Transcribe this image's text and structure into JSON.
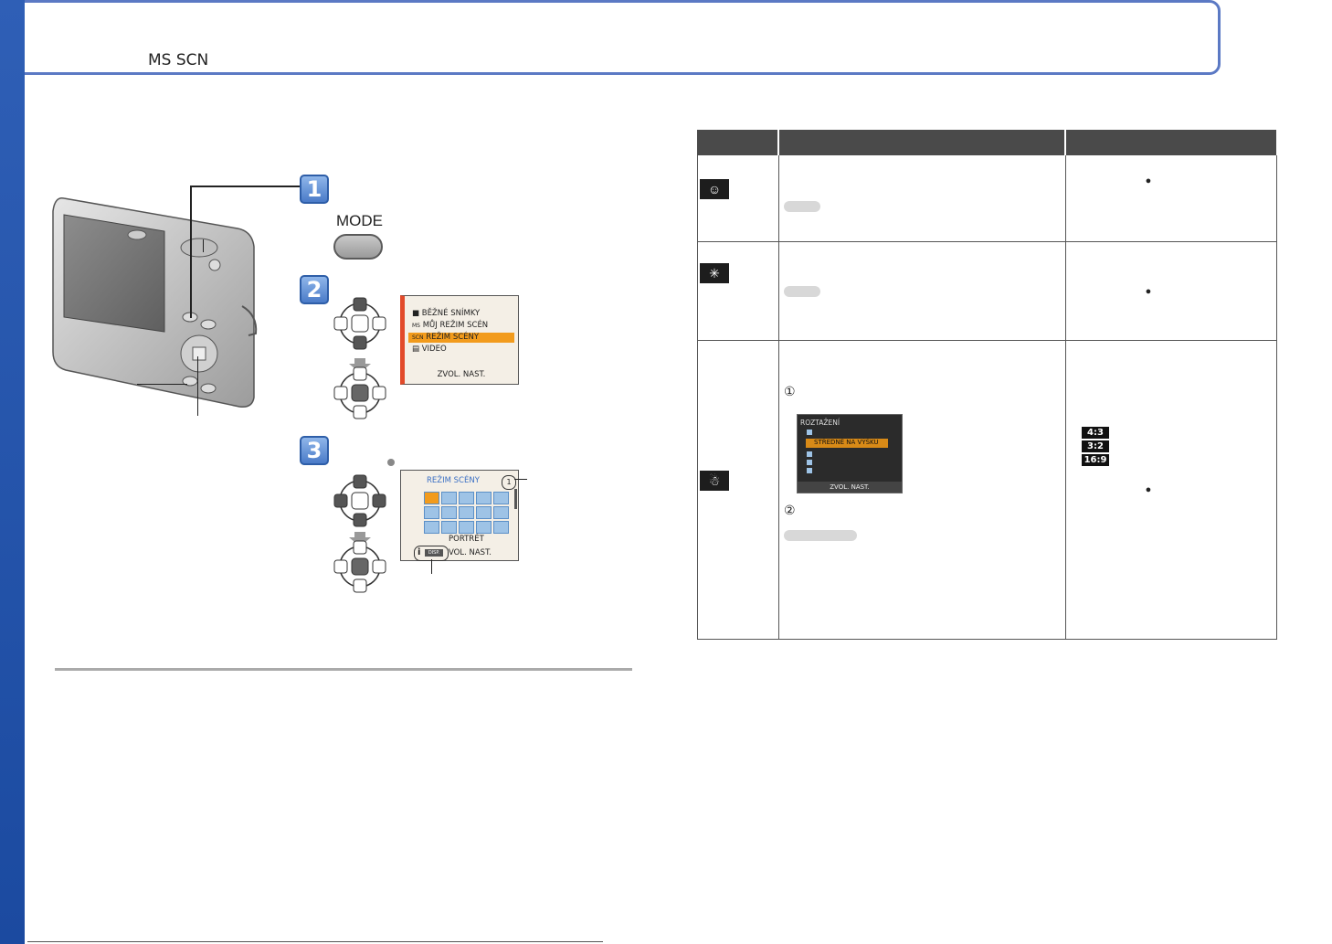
{
  "header": {
    "mode_icons": "MS SCN"
  },
  "steps": [
    {
      "number": "1",
      "button_label": "MODE"
    },
    {
      "number": "2"
    },
    {
      "number": "3"
    }
  ],
  "menu_screen": {
    "items": [
      "BĚŽNÉ SNÍMKY",
      "MŮJ REŽIM SCÉN",
      "REŽIM SCÉNY",
      "VIDEO"
    ],
    "item_prefixes": [
      "■",
      "MS",
      "SCN",
      "▤"
    ],
    "selected_index": 2,
    "footer": "ZVOL.  NAST."
  },
  "scene_screen": {
    "title": "REŽIM SCÉNY",
    "page_badge": "1",
    "selected_name": "PORTRÉT",
    "footer": "VOL.  NAST.",
    "info_icon": "i",
    "disp_label": "DISP."
  },
  "stretch_screen": {
    "title": "ROZTAŽENÍ",
    "selected_option": "STŘEDNĚ NA VÝŠKU",
    "footer": "ZVOL.  NAST."
  },
  "table": {
    "numbered_markers": [
      "①",
      "②"
    ],
    "aspect_ratios": [
      "4:3",
      "3:2",
      "16:9"
    ]
  },
  "colors": {
    "banner_border": "#5b79c4",
    "banner_tab": "#2f5fb6",
    "selection": "#f29b1c",
    "table_header": "#4a4a4a"
  }
}
